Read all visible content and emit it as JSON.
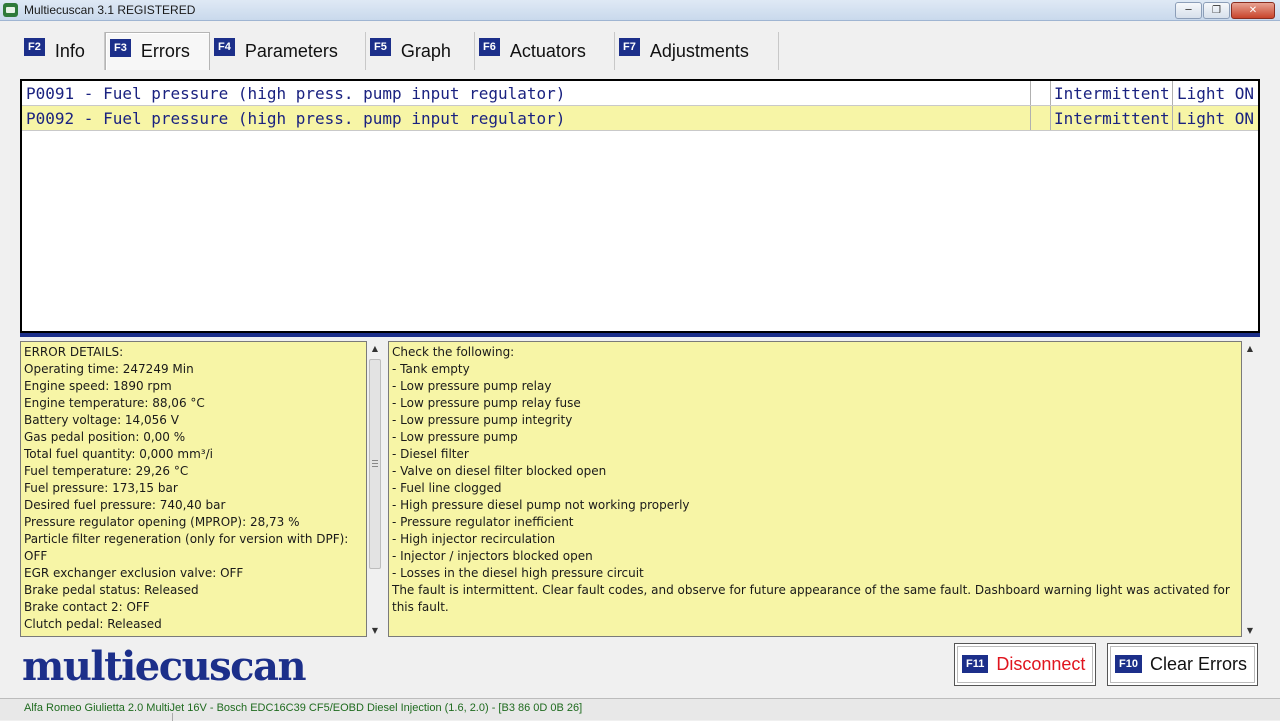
{
  "window": {
    "title": "Multiecuscan 3.1 REGISTERED"
  },
  "tabs": [
    {
      "key": "F2",
      "label": "Info",
      "active": false
    },
    {
      "key": "F3",
      "label": "Errors",
      "active": true
    },
    {
      "key": "F4",
      "label": "Parameters",
      "active": false
    },
    {
      "key": "F5",
      "label": "Graph",
      "active": false
    },
    {
      "key": "F6",
      "label": "Actuators",
      "active": false
    },
    {
      "key": "F7",
      "label": "Adjustments",
      "active": false
    }
  ],
  "errors": [
    {
      "code": "P0091 - Fuel pressure (high press. pump input regulator)",
      "status": "Intermittent",
      "light": "Light ON",
      "selected": false
    },
    {
      "code": "P0092 - Fuel pressure (high press. pump input regulator)",
      "status": "Intermittent",
      "light": "Light ON",
      "selected": true
    }
  ],
  "details": [
    "ERROR DETAILS:",
    "Operating time: 247249 Min",
    "Engine speed: 1890 rpm",
    "Engine temperature: 88,06 °C",
    "Battery voltage: 14,056 V",
    "Gas pedal position: 0,00 %",
    "Total fuel quantity: 0,000 mm³/i",
    "Fuel temperature: 29,26 °C",
    "Fuel pressure: 173,15 bar",
    "Desired fuel pressure: 740,40 bar",
    "Pressure regulator opening (MPROP): 28,73 %",
    "Particle filter regeneration (only for version with DPF): OFF",
    "EGR exchanger exclusion valve: OFF",
    "Brake pedal status: Released",
    "Brake contact 2: OFF",
    "Clutch pedal: Released"
  ],
  "checklist": [
    "Check the following:",
    "- Tank empty",
    "- Low pressure pump relay",
    "- Low pressure pump relay fuse",
    "- Low pressure pump integrity",
    "- Low pressure pump",
    "- Diesel filter",
    "- Valve on diesel filter blocked open",
    "- Fuel line clogged",
    "- High pressure diesel pump not working properly",
    "- Pressure regulator inefficient",
    "- High injector recirculation",
    "- Injector / injectors blocked open",
    "- Losses in the diesel high pressure circuit",
    "The fault is intermittent. Clear fault codes, and observe for future appearance of the same fault. Dashboard warning light was activated for this fault."
  ],
  "logo": "multiecuscan",
  "buttons": {
    "disconnect": {
      "key": "F11",
      "label": "Disconnect"
    },
    "clear": {
      "key": "F10",
      "label": "Clear Errors"
    }
  },
  "status": "Alfa Romeo Giulietta 2.0 MultiJet 16V - Bosch EDC16C39 CF5/EOBD Diesel Injection (1.6, 2.0) - [B3 86 0D 0B 26]",
  "colors": {
    "accent": "#1c2f8a",
    "panel": "#f7f5a6",
    "disconnect": "#e0141e",
    "status": "#1f6b1f"
  }
}
